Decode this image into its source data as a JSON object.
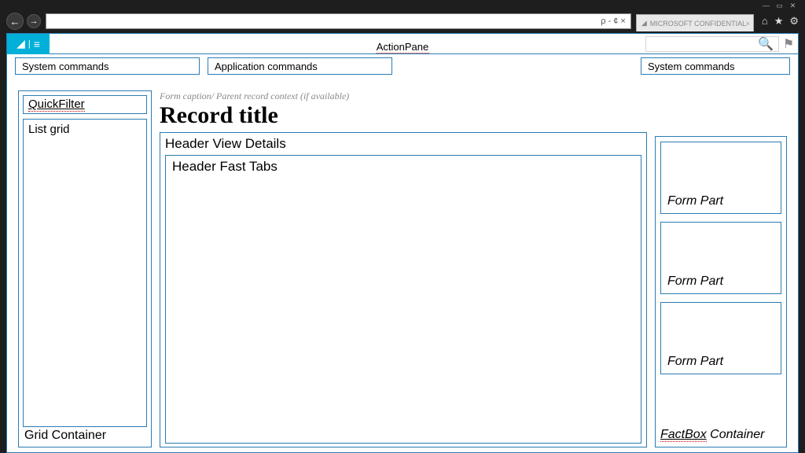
{
  "window": {
    "tab_title": "MICROSOFT CONFIDENTIAL",
    "address_controls": "ρ - ¢ ×"
  },
  "actionpane": {
    "label": "ActionPane",
    "left": "System commands",
    "center": "Application commands",
    "right": "System commands"
  },
  "grid": {
    "quickfilter": "QuickFilter",
    "listgrid": "List grid",
    "container_label": "Grid Container"
  },
  "main": {
    "caption": "Form caption/ Parent record context (if available)",
    "title": "Record title",
    "header_view": "Header View Details",
    "fast_tabs": "Header Fast Tabs"
  },
  "factbox": {
    "parts": [
      "Form Part",
      "Form Part",
      "Form Part"
    ],
    "container_label_prefix": "FactBox",
    "container_label_suffix": " Container"
  }
}
